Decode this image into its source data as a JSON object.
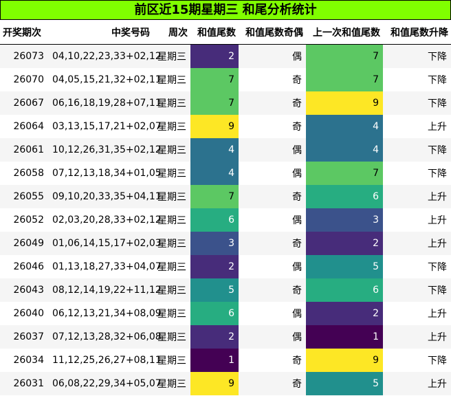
{
  "title": "前区近15期星期三 和尾分析统计",
  "headers": [
    "开奖期次",
    "中奖号码",
    "周次",
    "和值尾数",
    "和值尾数奇偶",
    "上一次和值尾数",
    "和值尾数升降"
  ],
  "heat_colors": {
    "1": "#440154",
    "2": "#472c7a",
    "3": "#3b528b",
    "4": "#2c728e",
    "5": "#21908d",
    "6": "#27ad81",
    "7": "#5cc863",
    "9": "#fde725"
  },
  "rows": [
    {
      "period": "26073",
      "numbers": "04,10,22,23,33+02,12",
      "weekday": "星期三",
      "tail": "2",
      "parity": "偶",
      "prev_tail": "7",
      "trend": "下降"
    },
    {
      "period": "26070",
      "numbers": "04,05,15,21,32+02,11",
      "weekday": "星期三",
      "tail": "7",
      "parity": "奇",
      "prev_tail": "7",
      "trend": "下降"
    },
    {
      "period": "26067",
      "numbers": "06,16,18,19,28+07,11",
      "weekday": "星期三",
      "tail": "7",
      "parity": "奇",
      "prev_tail": "9",
      "trend": "下降"
    },
    {
      "period": "26064",
      "numbers": "03,13,15,17,21+02,07",
      "weekday": "星期三",
      "tail": "9",
      "parity": "奇",
      "prev_tail": "4",
      "trend": "上升"
    },
    {
      "period": "26061",
      "numbers": "10,12,26,31,35+02,12",
      "weekday": "星期三",
      "tail": "4",
      "parity": "偶",
      "prev_tail": "4",
      "trend": "下降"
    },
    {
      "period": "26058",
      "numbers": "07,12,13,18,34+01,05",
      "weekday": "星期三",
      "tail": "4",
      "parity": "偶",
      "prev_tail": "7",
      "trend": "下降"
    },
    {
      "period": "26055",
      "numbers": "09,10,20,33,35+04,11",
      "weekday": "星期三",
      "tail": "7",
      "parity": "奇",
      "prev_tail": "6",
      "trend": "上升"
    },
    {
      "period": "26052",
      "numbers": "02,03,20,28,33+02,12",
      "weekday": "星期三",
      "tail": "6",
      "parity": "偶",
      "prev_tail": "3",
      "trend": "上升"
    },
    {
      "period": "26049",
      "numbers": "01,06,14,15,17+02,03",
      "weekday": "星期三",
      "tail": "3",
      "parity": "奇",
      "prev_tail": "2",
      "trend": "上升"
    },
    {
      "period": "26046",
      "numbers": "01,13,18,27,33+04,07",
      "weekday": "星期三",
      "tail": "2",
      "parity": "偶",
      "prev_tail": "5",
      "trend": "下降"
    },
    {
      "period": "26043",
      "numbers": "08,12,14,19,22+11,12",
      "weekday": "星期三",
      "tail": "5",
      "parity": "奇",
      "prev_tail": "6",
      "trend": "下降"
    },
    {
      "period": "26040",
      "numbers": "06,12,13,21,34+08,09",
      "weekday": "星期三",
      "tail": "6",
      "parity": "偶",
      "prev_tail": "2",
      "trend": "上升"
    },
    {
      "period": "26037",
      "numbers": "07,12,13,28,32+06,08",
      "weekday": "星期三",
      "tail": "2",
      "parity": "偶",
      "prev_tail": "1",
      "trend": "上升"
    },
    {
      "period": "26034",
      "numbers": "11,12,25,26,27+08,11",
      "weekday": "星期三",
      "tail": "1",
      "parity": "奇",
      "prev_tail": "9",
      "trend": "下降"
    },
    {
      "period": "26031",
      "numbers": "06,08,22,29,34+05,07",
      "weekday": "星期三",
      "tail": "9",
      "parity": "奇",
      "prev_tail": "5",
      "trend": "上升"
    }
  ]
}
